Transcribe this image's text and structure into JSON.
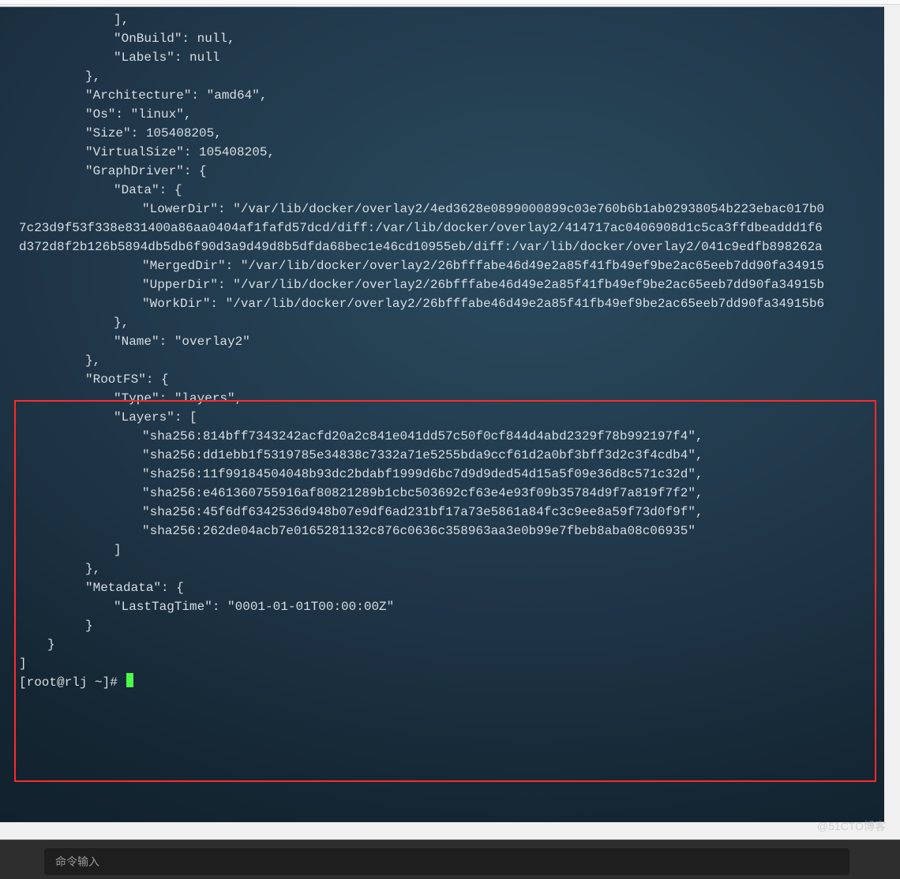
{
  "terminal": {
    "lines": [
      {
        "cls": "indent3",
        "text": "],"
      },
      {
        "cls": "indent3",
        "text": "\"OnBuild\": null,"
      },
      {
        "cls": "indent3",
        "text": "\"Labels\": null"
      },
      {
        "cls": "indent2",
        "text": "},"
      },
      {
        "cls": "indent2",
        "text": "\"Architecture\": \"amd64\","
      },
      {
        "cls": "indent2",
        "text": "\"Os\": \"linux\","
      },
      {
        "cls": "indent2",
        "text": "\"Size\": 105408205,"
      },
      {
        "cls": "indent2",
        "text": "\"VirtualSize\": 105408205,"
      },
      {
        "cls": "indent2",
        "text": "\"GraphDriver\": {"
      },
      {
        "cls": "indent3",
        "text": "\"Data\": {"
      },
      {
        "cls": "indent4",
        "text": "\"LowerDir\": \"/var/lib/docker/overlay2/4ed3628e0899000899c03e760b6b1ab02938054b223ebac017b0"
      },
      {
        "cls": "wrapline",
        "text": "7c23d9f53f338e831400a86aa0404af1fafd57dcd/diff:/var/lib/docker/overlay2/414717ac0406908d1c5ca3ffdbeaddd1f6"
      },
      {
        "cls": "wrapline",
        "text": "d372d8f2b126b5894db5db6f90d3a9d49d8b5dfda68bec1e46cd10955eb/diff:/var/lib/docker/overlay2/041c9edfb898262a"
      },
      {
        "cls": "indent4",
        "text": "\"MergedDir\": \"/var/lib/docker/overlay2/26bfffabe46d49e2a85f41fb49ef9be2ac65eeb7dd90fa34915"
      },
      {
        "cls": "indent4",
        "text": "\"UpperDir\": \"/var/lib/docker/overlay2/26bfffabe46d49e2a85f41fb49ef9be2ac65eeb7dd90fa34915b"
      },
      {
        "cls": "indent4",
        "text": "\"WorkDir\": \"/var/lib/docker/overlay2/26bfffabe46d49e2a85f41fb49ef9be2ac65eeb7dd90fa34915b6"
      },
      {
        "cls": "indent3",
        "text": "},"
      },
      {
        "cls": "indent3",
        "text": "\"Name\": \"overlay2\""
      },
      {
        "cls": "indent2",
        "text": "},"
      },
      {
        "cls": "indent2",
        "text": "\"RootFS\": {"
      },
      {
        "cls": "indent3",
        "text": "\"Type\": \"layers\","
      },
      {
        "cls": "indent3",
        "text": "\"Layers\": ["
      },
      {
        "cls": "indent4",
        "text": "\"sha256:814bff7343242acfd20a2c841e041dd57c50f0cf844d4abd2329f78b992197f4\","
      },
      {
        "cls": "indent4",
        "text": "\"sha256:dd1ebb1f5319785e34838c7332a71e5255bda9ccf61d2a0bf3bff3d2c3f4cdb4\","
      },
      {
        "cls": "indent4",
        "text": "\"sha256:11f99184504048b93dc2bdabf1999d6bc7d9d9ded54d15a5f09e36d8c571c32d\","
      },
      {
        "cls": "indent4",
        "text": "\"sha256:e461360755916af80821289b1cbc503692cf63e4e93f09b35784d9f7a819f7f2\","
      },
      {
        "cls": "indent4",
        "text": "\"sha256:45f6df6342536d948b07e9df6ad231bf17a73e5861a84fc3c9ee8a59f73d0f9f\","
      },
      {
        "cls": "indent4",
        "text": "\"sha256:262de04acb7e0165281132c876c0636c358963aa3e0b99e7fbeb8aba08c06935\""
      },
      {
        "cls": "indent3",
        "text": "]"
      },
      {
        "cls": "indent2",
        "text": "},"
      },
      {
        "cls": "indent2",
        "text": "\"Metadata\": {"
      },
      {
        "cls": "indent3",
        "text": "\"LastTagTime\": \"0001-01-01T00:00:00Z\""
      },
      {
        "cls": "indent2",
        "text": "}"
      },
      {
        "cls": "indent1",
        "text": "}"
      },
      {
        "cls": "indent0",
        "text": "]"
      }
    ],
    "prompt": "[root@rlj ~]#"
  },
  "bottom": {
    "placeholder": "命令输入"
  },
  "watermark": "@51CTO博客"
}
